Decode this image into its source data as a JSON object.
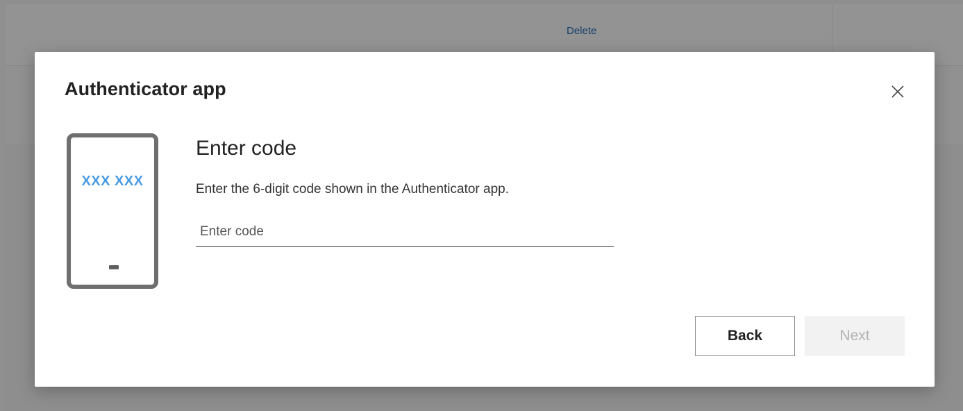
{
  "background": {
    "delete_link": "Delete"
  },
  "dialog": {
    "title": "Authenticator app",
    "close_icon": "close-icon",
    "illustration": {
      "code_text": "XXX XXX"
    },
    "heading": "Enter code",
    "instruction": "Enter the 6-digit code shown in the Authenticator app.",
    "code_input": {
      "value": "",
      "placeholder": "Enter code"
    },
    "buttons": {
      "back": "Back",
      "next": "Next"
    }
  },
  "colors": {
    "accent_code": "#4a9be3",
    "link": "#15406b",
    "disabled_text": "#b3b3b3"
  }
}
